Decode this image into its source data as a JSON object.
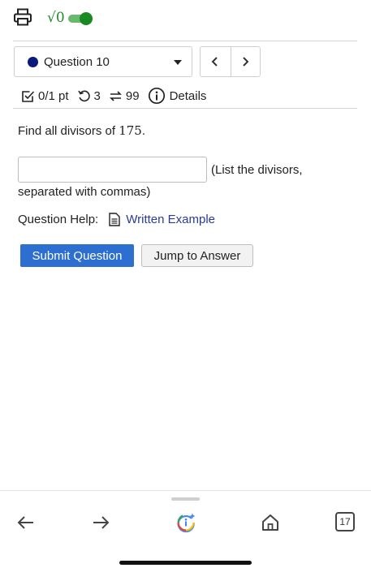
{
  "toolbar": {
    "print_icon": "printer-icon",
    "sqrt_label": "√0",
    "sqrt_toggle_on": true,
    "accent_color": "#178a22"
  },
  "question_nav": {
    "selected_question": "Question 10",
    "status_dot_color": "#0a1a7a",
    "prev_label": "<",
    "next_label": ">"
  },
  "meta": {
    "score": "0/1 pt",
    "retries": "3",
    "submissions": "99",
    "details_label": "Details"
  },
  "question": {
    "prompt_prefix": "Find all divisors of ",
    "number": "175",
    "prompt_suffix": ".",
    "answer_value": "",
    "hint_line1": "(List the divisors,",
    "hint_line2": "separated with commas)"
  },
  "help": {
    "label": "Question Help:",
    "link_text": "Written Example"
  },
  "actions": {
    "submit_label": "Submit Question",
    "submit_color": "#2c6fd1",
    "jump_label": "Jump to Answer"
  },
  "browser_bar": {
    "back_icon": "arrow-left-icon",
    "forward_icon": "arrow-right-icon",
    "assistant_icon": "google-lens-sparkle-icon",
    "home_icon": "home-icon",
    "tab_count": "17"
  }
}
